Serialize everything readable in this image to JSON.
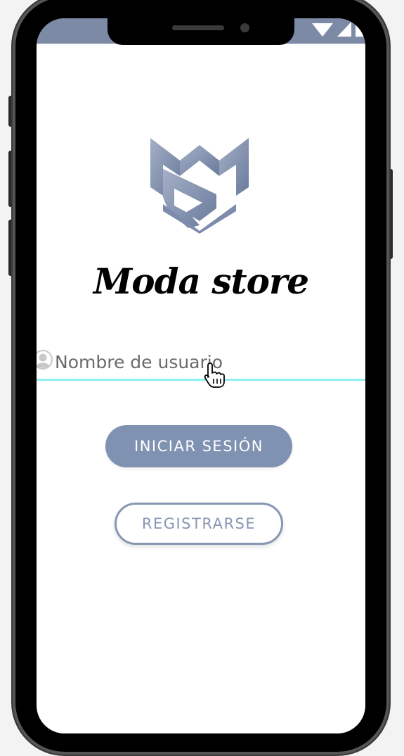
{
  "app": {
    "brand_name": "Moda store",
    "logo_icon": "ms-monogram-logo"
  },
  "login_form": {
    "username_placeholder": "Nombre de usuario",
    "username_value": "",
    "field_icon": "user-circle-icon"
  },
  "actions": {
    "login_label": "INICIAR SESIÓN",
    "register_label": "REGISTRARSE"
  },
  "status_bar": {
    "icons": [
      "wifi-icon",
      "cellular-signal-icon",
      "battery-icon"
    ]
  },
  "colors": {
    "status_bar": "#7c8aa6",
    "primary_button": "#7f92b1",
    "outline_button": "#8797b3",
    "input_underline": "#8ff0f4",
    "logo": "#7d8cad"
  }
}
